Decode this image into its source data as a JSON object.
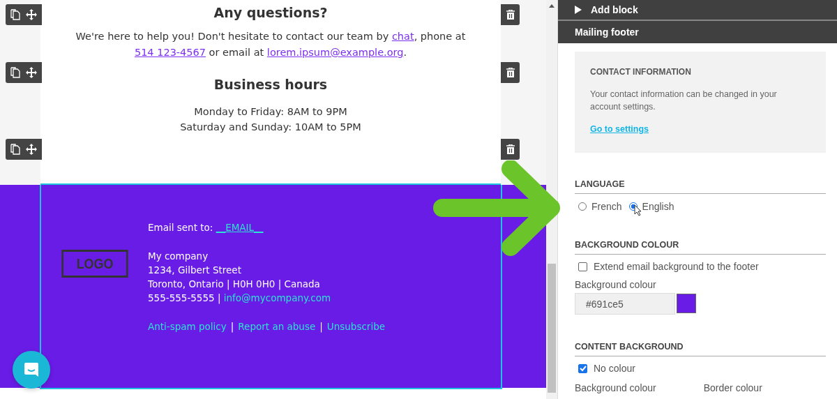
{
  "email_content": {
    "questions_heading": "Any questions?",
    "questions_text": [
      {
        "text": "We're here to help you! Don't hesitate to contact our team by ",
        "link": false
      },
      {
        "text": "chat",
        "link": true
      },
      {
        "text": ", phone at ",
        "link": false
      },
      {
        "text": "514 123-4567",
        "link": true
      },
      {
        "text": " or email at ",
        "link": false
      },
      {
        "text": "lorem.ipsum@example.org",
        "link": true
      },
      {
        "text": ".",
        "link": false
      }
    ],
    "hours_heading": "Business hours",
    "hours": [
      "Monday to Friday: 8AM to 9PM",
      "Saturday and Sunday: 10AM to 5PM"
    ]
  },
  "footer": {
    "email_label": "Email sent to:",
    "email_value": "__EMAIL__",
    "logo": "LOGO",
    "company_lines": [
      "My company",
      "1234, Gilbert Street",
      "Toronto, Ontario | H0H 0H0 | Canada"
    ],
    "phone": "555-555-5555",
    "separator": "|",
    "contact_email": "info@mycompany.com",
    "links": [
      "Anti-spam policy",
      "Report an abuse",
      "Unsubscribe"
    ]
  },
  "panel": {
    "add_block": {
      "label": "Add block",
      "expanded": false
    },
    "section_title": "Mailing footer",
    "contact_card": {
      "title": "CONTACT INFORMATION",
      "text": "Your contact information can be changed in your account settings.",
      "link": "Go to settings"
    },
    "language": {
      "title": "LANGUAGE",
      "options": [
        {
          "label": "French",
          "selected": false
        },
        {
          "label": "English",
          "selected": true
        }
      ]
    },
    "background_colour": {
      "title": "BACKGROUND COLOUR",
      "extend_label": "Extend email background to the footer",
      "extend_checked": false,
      "field_label": "Background colour",
      "value": "#691ce5"
    },
    "content_background": {
      "title": "CONTENT BACKGROUND",
      "no_colour_label": "No colour",
      "no_colour_checked": true,
      "background_label": "Background colour",
      "border_label": "Border colour"
    }
  }
}
